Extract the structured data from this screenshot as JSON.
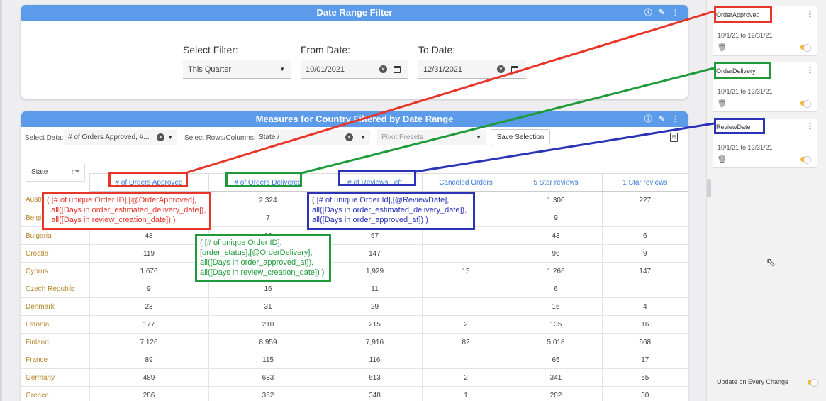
{
  "date_filter_card": {
    "title": "Date Range Filter",
    "select_filter_label": "Select Filter:",
    "select_filter_value": "This Quarter",
    "from_date_label": "From Date:",
    "from_date_value": "10/01/2021",
    "to_date_label": "To Date:",
    "to_date_value": "12/31/2021"
  },
  "measures_card": {
    "title": "Measures for Country Filtered by Date Range",
    "select_data_label": "Select Data:",
    "select_data_value": "# of Orders Approved, #...",
    "rows_columns_label": "Select Rows/Columns:",
    "rows_columns_value": "State /",
    "pivot_placeholder": "Pivot Presets",
    "save_button": "Save Selection",
    "state_filter_label": "State",
    "columns": [
      "# of Orders Approved",
      "# of Orders Delivered",
      "# of Reviews Left",
      "Canceled Orders",
      "5 Star reviews",
      "1 Star reviews"
    ],
    "rows": [
      {
        "state": "Austria",
        "values": [
          "",
          "2,324",
          "",
          "",
          "1,300",
          "227"
        ]
      },
      {
        "state": "Belgium",
        "values": [
          "",
          "7",
          "",
          "",
          "9",
          ""
        ]
      },
      {
        "state": "Bulgaria",
        "values": [
          "48",
          "66",
          "67",
          "",
          "43",
          "6"
        ]
      },
      {
        "state": "Croatia",
        "values": [
          "119",
          "",
          "147",
          "",
          "96",
          "9"
        ]
      },
      {
        "state": "Cyprus",
        "values": [
          "1,676",
          "",
          "1,929",
          "15",
          "1,266",
          "147"
        ]
      },
      {
        "state": "Czech Republic",
        "values": [
          "9",
          "16",
          "11",
          "",
          "6",
          ""
        ]
      },
      {
        "state": "Denmark",
        "values": [
          "23",
          "31",
          "29",
          "",
          "16",
          "4"
        ]
      },
      {
        "state": "Estonia",
        "values": [
          "177",
          "210",
          "215",
          "2",
          "135",
          "16"
        ]
      },
      {
        "state": "Finland",
        "values": [
          "7,126",
          "8,959",
          "7,916",
          "82",
          "5,018",
          "668"
        ]
      },
      {
        "state": "France",
        "values": [
          "89",
          "115",
          "116",
          "",
          "65",
          "17"
        ]
      },
      {
        "state": "Germany",
        "values": [
          "489",
          "633",
          "613",
          "2",
          "341",
          "55"
        ]
      },
      {
        "state": "Greece",
        "values": [
          "286",
          "362",
          "348",
          "1",
          "202",
          "30"
        ]
      }
    ]
  },
  "filter_panel": {
    "cards": [
      {
        "name": "OrderApproved",
        "range": "10/1/21 to 12/31/21"
      },
      {
        "name": "OrderDelivery",
        "range": "10/1/21 to 12/31/21"
      },
      {
        "name": "ReviewDate",
        "range": "10/1/21 to 12/31/21"
      }
    ],
    "update_label": "Update on Every Change"
  },
  "annotations": {
    "red_formula": "( [# of unique Order ID],[@OrderApproved],\n  all([Days in order_estimated_delivery_date]),\n  all([Days in review_creation_date]) )",
    "green_formula": "( [# of unique Order ID],\n[order_status],[@OrderDelivery],\nall([Days in order_approved_at]),\nall([Days in review_creation_date]) )",
    "blue_formula": "( [# of unique Order Id],[@ReviewDate],\nall([Days in order_estimated_delivery_date]),\nall([Days in order_approved_at]) )",
    "colors": {
      "red": "#e8352a",
      "green": "#1f9a3a",
      "blue": "#2b32b8"
    }
  },
  "theme": {
    "header_blue": "#5b9bea",
    "toggle_yellow": "#f2b92b",
    "state_text": "#b8862f",
    "column_text": "#3b7dd8"
  }
}
